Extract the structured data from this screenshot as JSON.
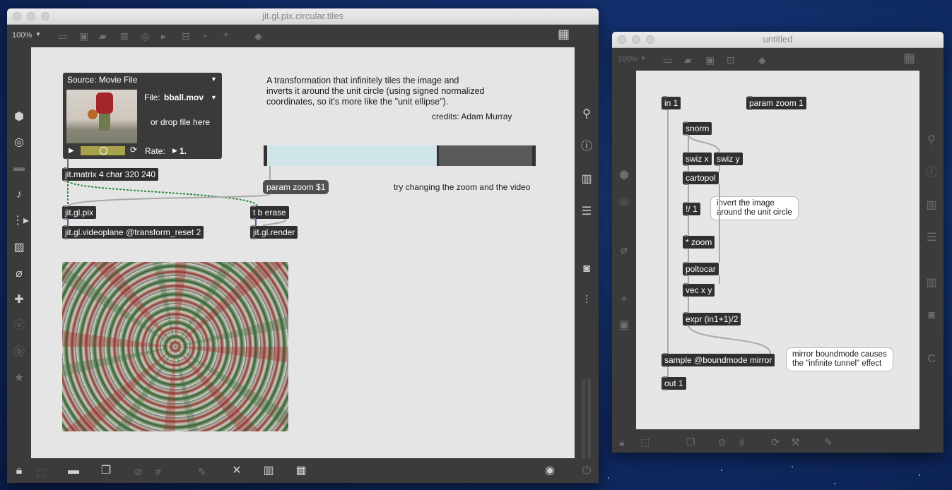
{
  "main_window": {
    "title": "jit.gl.pix.circular.tiles",
    "zoom": "100%",
    "playlist": {
      "header": "Source: Movie File",
      "file_label": "File:",
      "file_value": "bball.mov",
      "drop_hint": "or drop file here",
      "rate_label": "Rate:",
      "rate_value": "1."
    },
    "description_lines": [
      "A transformation that infinitely tiles the image and",
      "inverts it around the unit circle (using signed normalized",
      "coordinates, so it's more like the \"unit ellipse\")."
    ],
    "credits": "credits: Adam Murray",
    "hint": "try changing the zoom and the video",
    "slider_value": 0.64,
    "objects": {
      "matrix": "jit.matrix 4 char 320 240",
      "pix": "jit.gl.pix",
      "videoplane": "jit.gl.videoplane @transform_reset 2",
      "tb_erase": "t b erase",
      "render": "jit.gl.render",
      "param_msg": "param zoom $1"
    }
  },
  "sub_window": {
    "title": "untitled",
    "zoom": "100%",
    "objects": {
      "in1": "in 1",
      "param": "param zoom 1",
      "snorm": "snorm",
      "swizx": "swiz x",
      "swizy": "swiz y",
      "cartopol": "cartopol",
      "div": "!/ 1",
      "mul": "* zoom",
      "poltocar": "poltocar",
      "vec": "vec x y",
      "expr": "expr (in1+1)/2",
      "sample": "sample @boundmode mirror",
      "out1": "out 1"
    },
    "comments": {
      "invert_l1": "invert the image",
      "invert_l2": "around the unit circle",
      "mirror_l1": "mirror boundmode causes",
      "mirror_l2": "the \"infinite tunnel\" effect"
    }
  }
}
